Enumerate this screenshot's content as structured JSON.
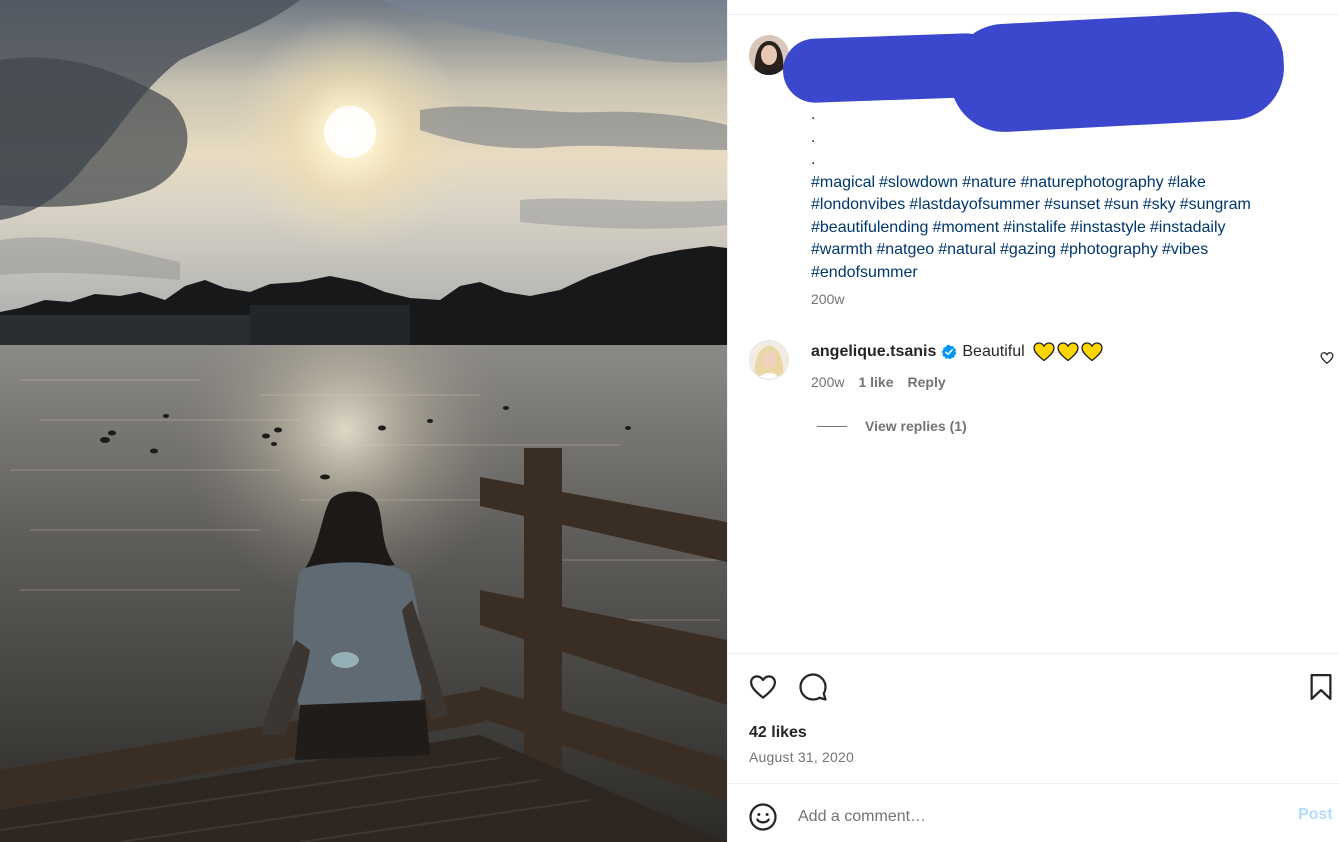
{
  "caption": {
    "dots": [
      ".",
      ".",
      "."
    ],
    "hashtags": [
      "#magical",
      "#slowdown",
      "#nature",
      "#naturephotography",
      "#lake",
      "#londonvibes",
      "#lastdayofsummer",
      "#sunset",
      "#sun",
      "#sky",
      "#sungram",
      "#beautifulending",
      "#moment",
      "#instalife",
      "#instastyle",
      "#instadaily",
      "#warmth",
      "#natgeo",
      "#natural",
      "#gazing",
      "#photography",
      "#vibes",
      "#endofsummer"
    ],
    "time": "200w"
  },
  "comment": {
    "username": "angelique.tsanis",
    "text": "Beautiful",
    "time": "200w",
    "likes": "1 like",
    "reply_label": "Reply",
    "view_replies": "View replies (1)"
  },
  "post": {
    "likes": "42 likes",
    "date": "August 31, 2020"
  },
  "composer": {
    "placeholder": "Add a comment…",
    "post_label": "Post"
  },
  "colors": {
    "hashtag": "#00376b",
    "redaction": "#3b47cc",
    "verified": "#0095f6",
    "post_button_disabled": "#b3dbff"
  },
  "icons": {
    "like": "heart-outline-icon",
    "comment": "speech-bubble-icon",
    "save": "bookmark-icon",
    "emoji": "smiley-icon",
    "verified": "verified-badge-icon"
  }
}
